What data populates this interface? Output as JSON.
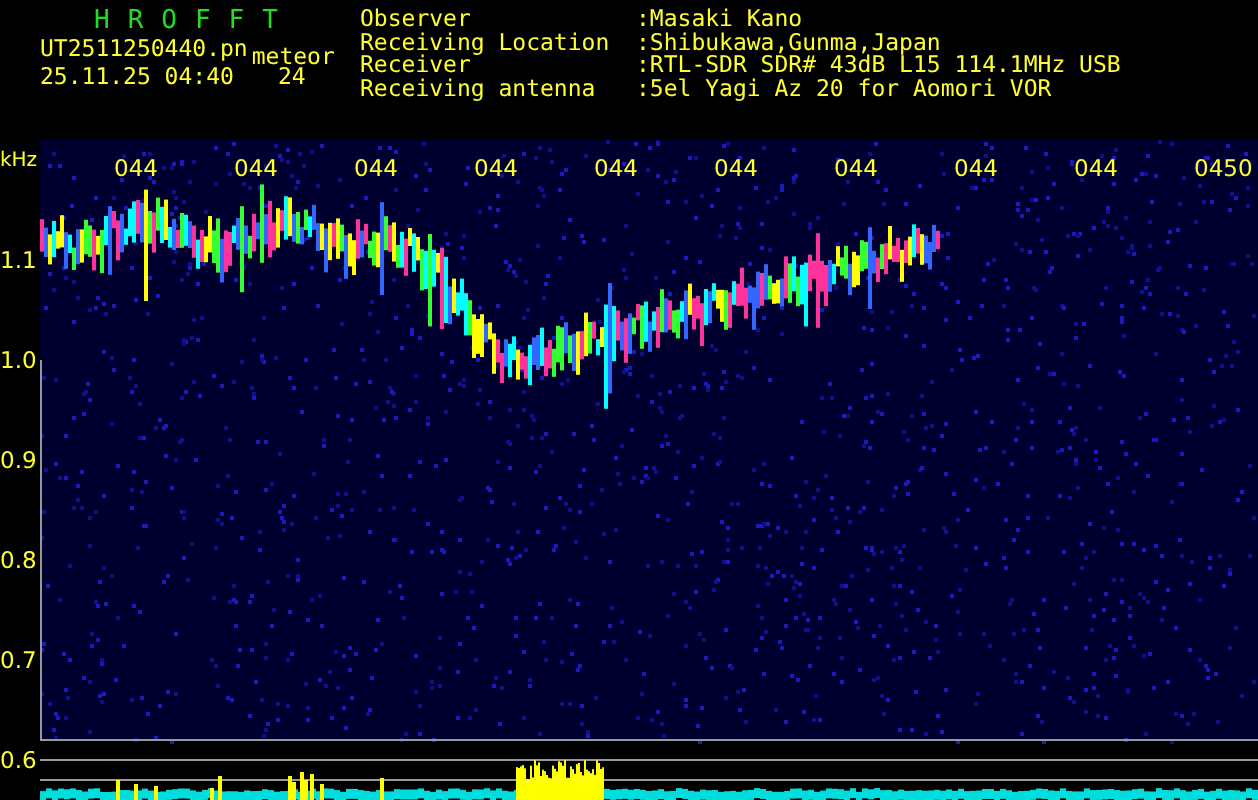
{
  "app_title": "HROFFT",
  "file_name": "UT2511250440.pn",
  "mode": "meteor",
  "timestamp": "25.11.25 04:40",
  "count": "24",
  "station_info": [
    {
      "label": "Observer",
      "value": ":Masaki Kano"
    },
    {
      "label": "Receiving Location",
      "value": ":Shibukawa,Gunma,Japan"
    },
    {
      "label": "Receiver",
      "value": ":RTL-SDR SDR# 43dB L15 114.1MHz USB"
    },
    {
      "label": "Receiving antenna",
      "value": ":5el Yagi Az 20 for Aomori VOR"
    }
  ],
  "axis_unit": "kHz",
  "frequency_labels": [
    "1.1",
    "1.0",
    "0.9",
    "0.8",
    "0.7",
    "0.6"
  ],
  "time_labels": [
    "044",
    "044",
    "044",
    "044",
    "044",
    "044",
    "044",
    "044",
    "044",
    "0450"
  ]
}
